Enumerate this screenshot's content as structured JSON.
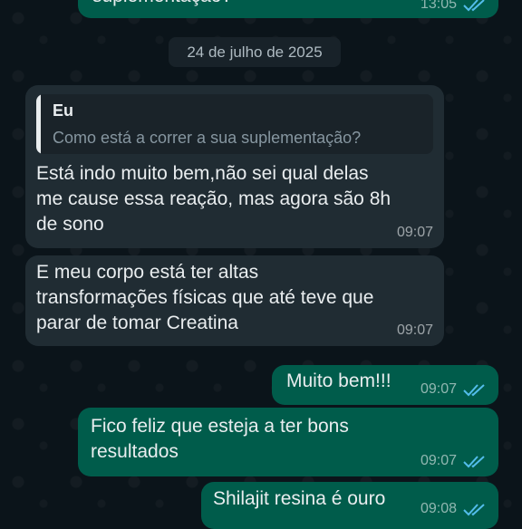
{
  "colors": {
    "incoming": "#202c33",
    "outgoing": "#005c4b",
    "read_ticks": "#53bdeb",
    "background": "#0b141a"
  },
  "messages": [
    {
      "id": "m0",
      "direction": "out",
      "text": "suplementação?",
      "time": "13:05",
      "status": "read"
    },
    {
      "id": "m1",
      "direction": "in",
      "reply_to": {
        "author": "Eu",
        "text": "Como está a correr a sua suplementação?"
      },
      "text": "Está indo muito bem,não sei qual delas\nme cause essa reação, mas agora são 8h\nde sono",
      "time": "09:07"
    },
    {
      "id": "m2",
      "direction": "in",
      "text": "E meu corpo está ter altas\ntransformações físicas que até teve que\nparar de tomar Creatina",
      "time": "09:07"
    },
    {
      "id": "m3",
      "direction": "out",
      "text": "Muito bem!!!",
      "time": "09:07",
      "status": "read"
    },
    {
      "id": "m4",
      "direction": "out",
      "text": "Fico feliz que esteja a ter bons\nresultados",
      "time": "09:07",
      "status": "read"
    },
    {
      "id": "m5",
      "direction": "out",
      "text": "Shilajit resina é ouro",
      "time": "09:08",
      "status": "read"
    }
  ],
  "date_separator": "24 de julho de 2025",
  "icons": {
    "read_receipt": "double-check-icon"
  }
}
